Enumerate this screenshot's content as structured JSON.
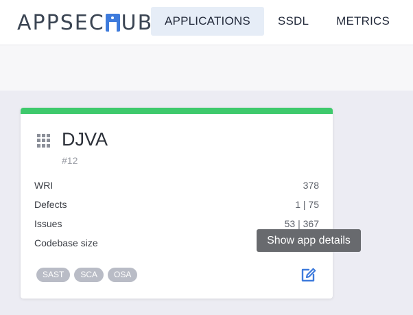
{
  "header": {
    "logo": {
      "text_left": "APPSEC",
      "text_right": "UB"
    },
    "nav": [
      {
        "label": "APPLICATIONS",
        "active": true
      },
      {
        "label": "SSDL",
        "active": false
      },
      {
        "label": "METRICS",
        "active": false
      }
    ]
  },
  "card": {
    "status_color": "#3ec96c",
    "icon": "grid-icon",
    "name": "DJVA",
    "id": "#12",
    "stats": [
      {
        "label": "WRI",
        "value": "378"
      },
      {
        "label": "Defects",
        "value": "1 | 75"
      },
      {
        "label": "Issues",
        "value": "53 | 367"
      },
      {
        "label": "Codebase size",
        "value": ""
      }
    ],
    "tags": [
      "SAST",
      "SCA",
      "OSA"
    ],
    "edit_icon": "edit-icon"
  },
  "tooltip": {
    "text": "Show app details"
  },
  "colors": {
    "accent": "#3e7bdc",
    "status": "#3ec96c",
    "tag_bg": "#b9bcc6"
  }
}
